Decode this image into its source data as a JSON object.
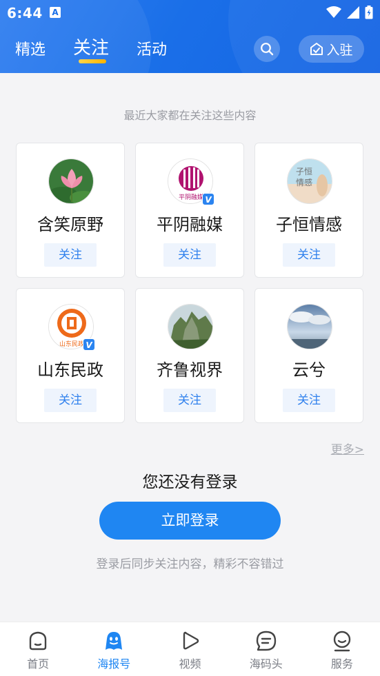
{
  "status": {
    "time": "6:44",
    "notification_glyph": "A"
  },
  "header": {
    "tabs": [
      {
        "label": "精选",
        "active": false
      },
      {
        "label": "关注",
        "active": true
      },
      {
        "label": "活动",
        "active": false
      }
    ],
    "join_label": "入驻"
  },
  "main": {
    "hint": "最近大家都在关注这些内容",
    "cards": [
      {
        "name": "含笑原野",
        "follow_label": "关注",
        "verified": false
      },
      {
        "name": "平阴融媒",
        "follow_label": "关注",
        "verified": true,
        "logo_text": "平阴融媒"
      },
      {
        "name": "子恒情感",
        "follow_label": "关注",
        "verified": false,
        "logo_text": "子恒\n情感"
      },
      {
        "name": "山东民政",
        "follow_label": "关注",
        "verified": true,
        "logo_text": "山东民政"
      },
      {
        "name": "齐鲁视界",
        "follow_label": "关注",
        "verified": false
      },
      {
        "name": "云兮",
        "follow_label": "关注",
        "verified": false
      }
    ],
    "more_label": "更多>",
    "login_title": "您还没有登录",
    "login_button": "立即登录",
    "login_hint": "登录后同步关注内容，精彩不容错过"
  },
  "bottom_nav": [
    {
      "label": "首页",
      "icon": "home-icon",
      "active": false
    },
    {
      "label": "海报号",
      "icon": "mascot-icon",
      "active": true
    },
    {
      "label": "视频",
      "icon": "play-icon",
      "active": false
    },
    {
      "label": "海码头",
      "icon": "chat-icon",
      "active": false
    },
    {
      "label": "服务",
      "icon": "service-icon",
      "active": false
    }
  ],
  "colors": {
    "header": "#1a6fe8",
    "accent": "#1f86f2",
    "tab_underline": "#ffc107",
    "follow_bg": "#eef4fd"
  }
}
